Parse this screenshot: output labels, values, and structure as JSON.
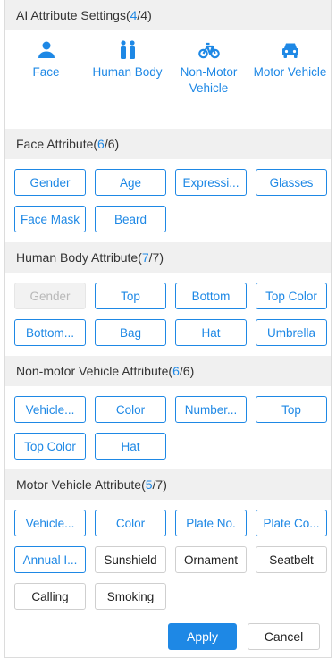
{
  "colors": {
    "accent": "#1e88e5",
    "header_bg": "#f0f0f0",
    "disabled_bg": "#f2f2f2"
  },
  "ai_settings": {
    "title": "AI Attribute Settings(",
    "count_selected": "4",
    "count_total": "/4)",
    "types": [
      {
        "label": "Face",
        "icon": "person-icon"
      },
      {
        "label": "Human Body",
        "icon": "group-people-icon"
      },
      {
        "label": "Non-Motor Vehicle",
        "icon": "bicycle-icon"
      },
      {
        "label": "Motor Vehicle",
        "icon": "car-icon"
      }
    ]
  },
  "sections": [
    {
      "title": "Face Attribute(",
      "count_selected": "6",
      "count_total": "/6)",
      "rows": [
        [
          {
            "label": "Gender",
            "state": "selected"
          },
          {
            "label": "Age",
            "state": "selected"
          },
          {
            "label": "Expressi...",
            "state": "selected"
          },
          {
            "label": "Glasses",
            "state": "selected"
          }
        ],
        [
          {
            "label": "Face Mask",
            "state": "selected"
          },
          {
            "label": "Beard",
            "state": "selected"
          }
        ]
      ]
    },
    {
      "title": "Human Body Attribute(",
      "count_selected": "7",
      "count_total": "/7)",
      "rows": [
        [
          {
            "label": "Gender",
            "state": "disabled"
          },
          {
            "label": "Top",
            "state": "selected"
          },
          {
            "label": "Bottom",
            "state": "selected"
          },
          {
            "label": "Top Color",
            "state": "selected"
          }
        ],
        [
          {
            "label": "Bottom...",
            "state": "selected"
          },
          {
            "label": "Bag",
            "state": "selected"
          },
          {
            "label": "Hat",
            "state": "selected"
          },
          {
            "label": "Umbrella",
            "state": "selected"
          }
        ]
      ]
    },
    {
      "title": "Non-motor Vehicle Attribute(",
      "count_selected": "6",
      "count_total": "/6)",
      "rows": [
        [
          {
            "label": "Vehicle...",
            "state": "selected"
          },
          {
            "label": "Color",
            "state": "selected"
          },
          {
            "label": "Number...",
            "state": "selected"
          },
          {
            "label": "Top",
            "state": "selected"
          }
        ],
        [
          {
            "label": "Top Color",
            "state": "selected"
          },
          {
            "label": "Hat",
            "state": "selected"
          }
        ]
      ]
    },
    {
      "title": "Motor Vehicle Attribute(",
      "count_selected": "5",
      "count_total": "/7)",
      "rows": [
        [
          {
            "label": "Vehicle...",
            "state": "selected"
          },
          {
            "label": "Color",
            "state": "selected"
          },
          {
            "label": "Plate No.",
            "state": "selected"
          },
          {
            "label": "Plate Co...",
            "state": "selected"
          }
        ],
        [
          {
            "label": "Annual I...",
            "state": "selected"
          },
          {
            "label": "Sunshield",
            "state": "normal"
          },
          {
            "label": "Ornament",
            "state": "normal"
          },
          {
            "label": "Seatbelt",
            "state": "normal"
          }
        ],
        [
          {
            "label": "Calling",
            "state": "normal"
          },
          {
            "label": "Smoking",
            "state": "normal"
          }
        ]
      ]
    }
  ],
  "footer": {
    "apply_label": "Apply",
    "cancel_label": "Cancel"
  }
}
